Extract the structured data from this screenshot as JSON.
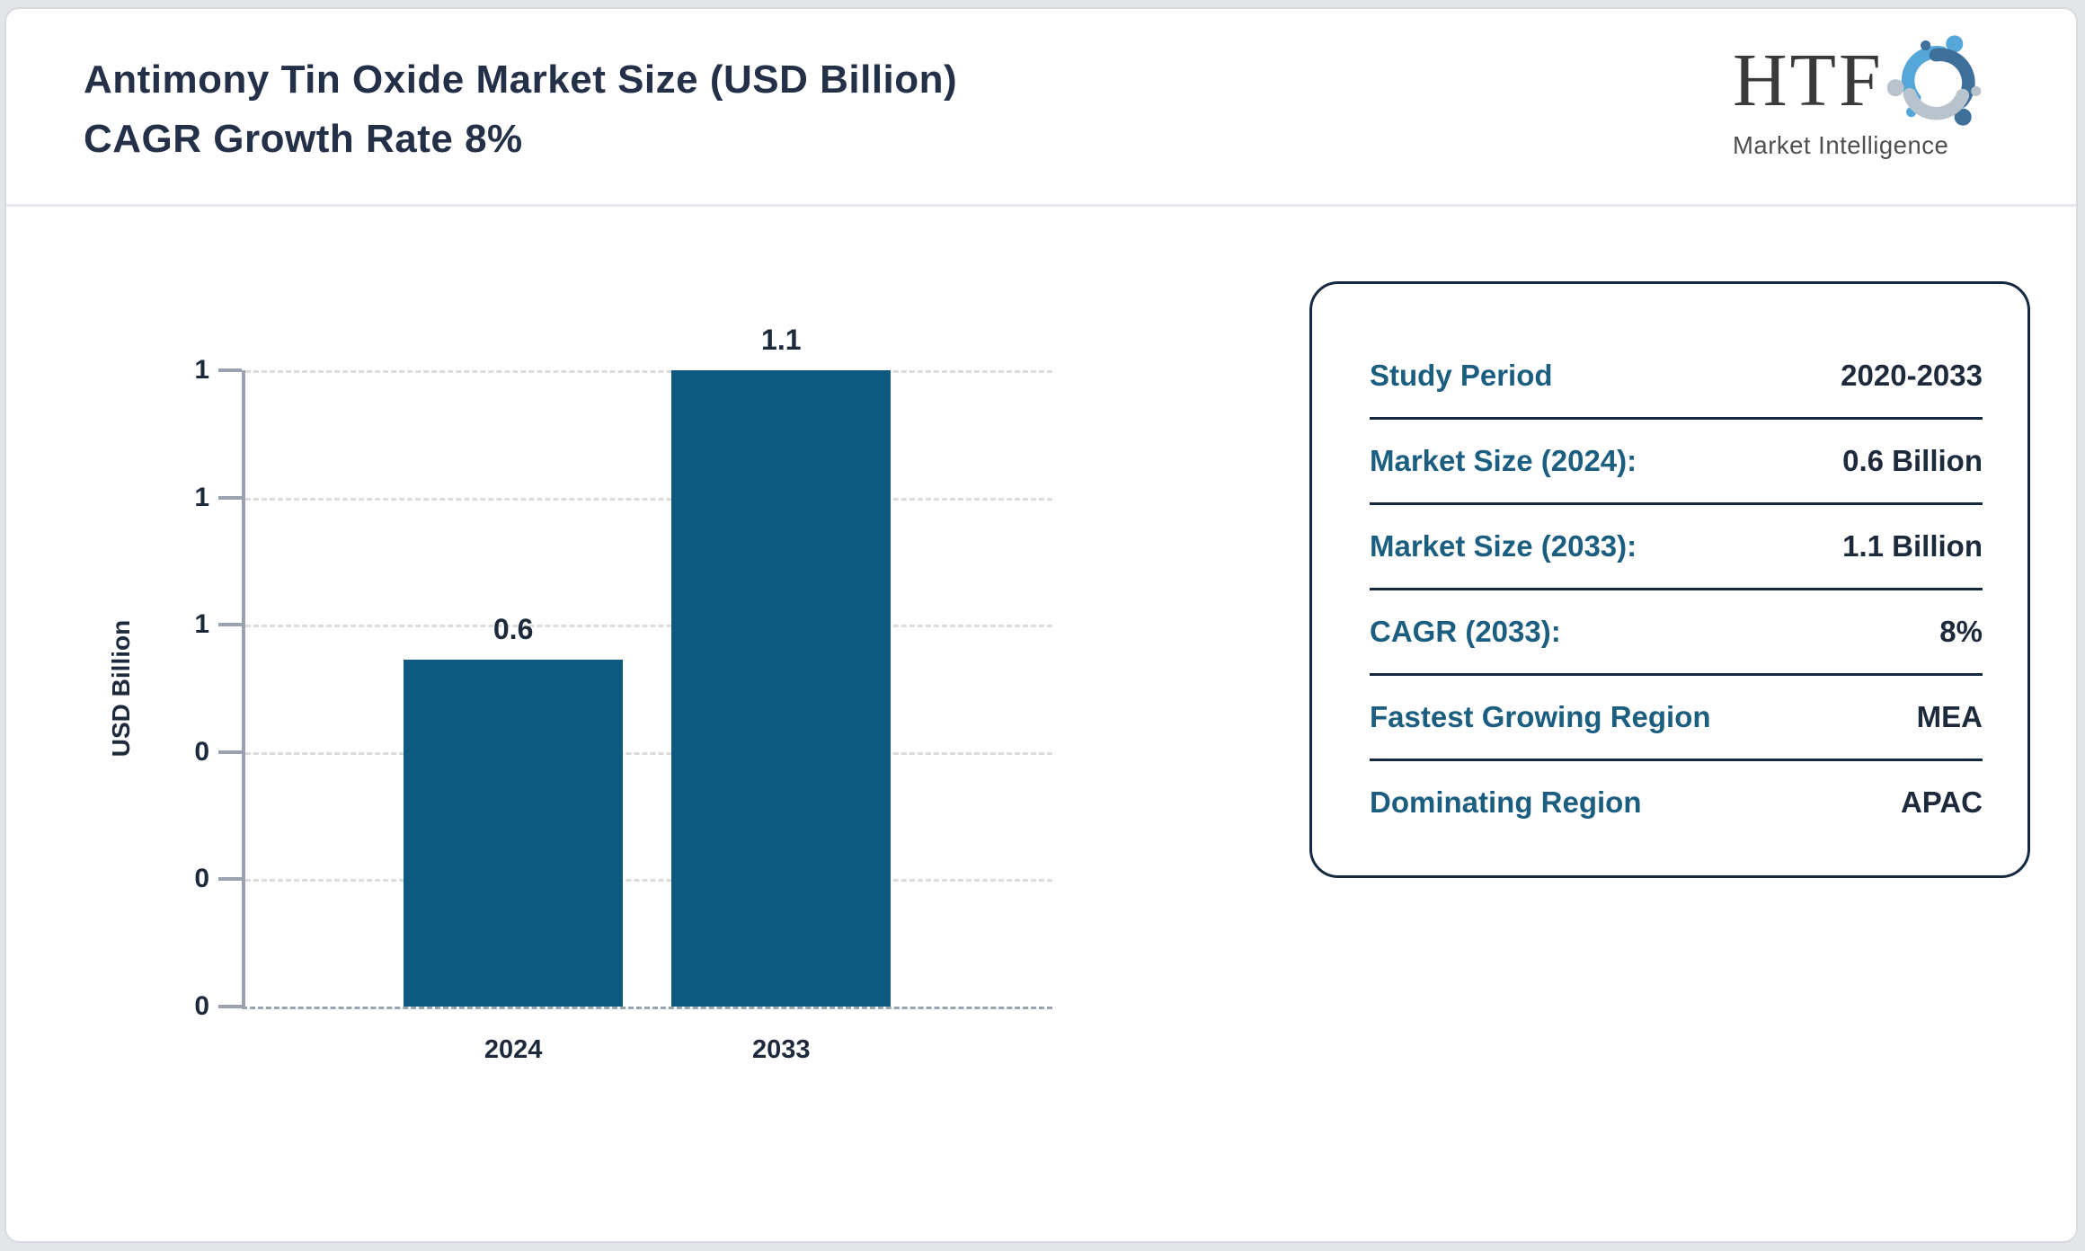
{
  "header": {
    "title_line1": "Antimony Tin Oxide Market Size (USD Billion)",
    "title_line2": "CAGR Growth Rate 8%"
  },
  "logo": {
    "text": "HTF",
    "subtext": "Market Intelligence",
    "colors": {
      "figure_top": "#54a7d8",
      "figure_right": "#3e7099",
      "figure_left": "#b9c3cd",
      "text": "#3a3a3c"
    }
  },
  "chart_data": {
    "type": "bar",
    "title": "Antimony Tin Oxide Market Size (USD Billion) CAGR Growth Rate 8%",
    "categories": [
      "2024",
      "2033"
    ],
    "values": [
      0.6,
      1.1
    ],
    "bar_labels": [
      "0.6",
      "1.1"
    ],
    "xlabel": "",
    "ylabel": "USD Billion",
    "ylim": [
      0,
      1.1
    ],
    "yticks": [
      {
        "value": 0,
        "label": "0"
      },
      {
        "value": 0.22,
        "label": "0"
      },
      {
        "value": 0.44,
        "label": "0"
      },
      {
        "value": 0.66,
        "label": "1"
      },
      {
        "value": 0.88,
        "label": "1"
      },
      {
        "value": 1.1,
        "label": "1"
      }
    ],
    "bar_color": "#0e5a7e",
    "grid": true,
    "legend": null
  },
  "info_card": {
    "label_color": "#1b5e80",
    "value_color": "#1d2a3c",
    "rows": [
      {
        "label": "Study Period",
        "value": "2020-2033"
      },
      {
        "label": "Market Size (2024):",
        "value": "0.6 Billion"
      },
      {
        "label": "Market Size (2033):",
        "value": "1.1 Billion"
      },
      {
        "label": "CAGR (2033):",
        "value": "8%"
      },
      {
        "label": "Fastest Growing Region",
        "value": "MEA"
      },
      {
        "label": "Dominating Region",
        "value": "APAC"
      }
    ]
  }
}
